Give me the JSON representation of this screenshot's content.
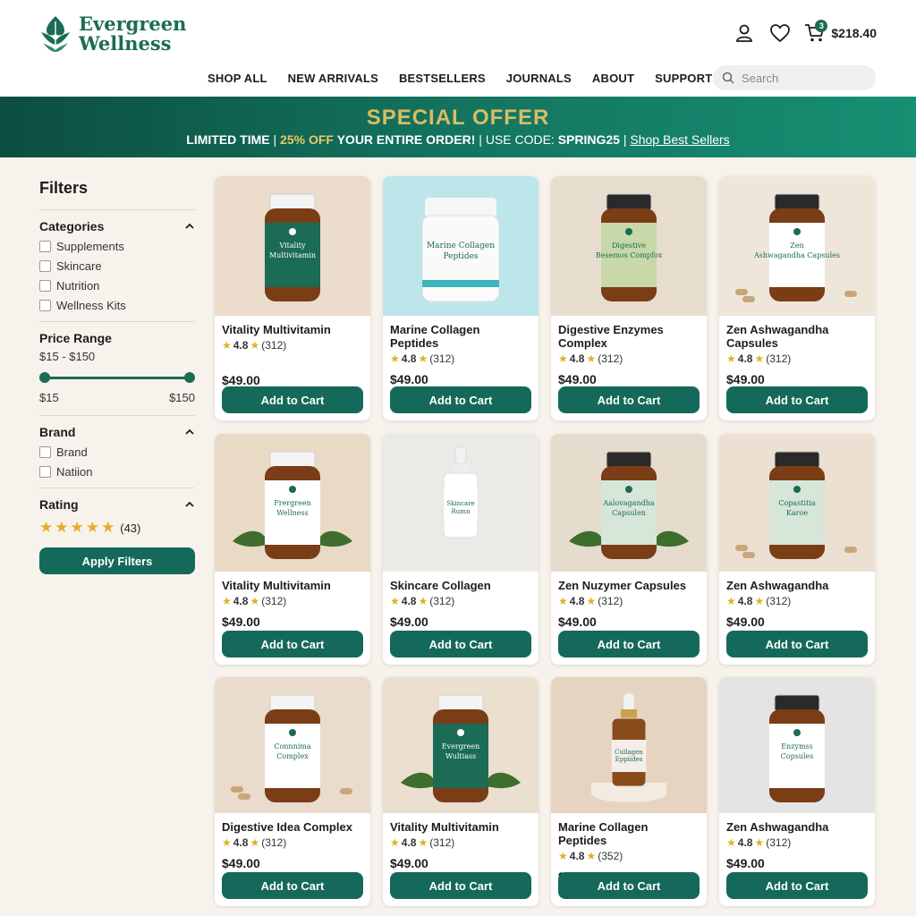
{
  "brand": {
    "line1": "Evergreen",
    "line2": "Wellness"
  },
  "header": {
    "cart_count": "3",
    "cart_total": "$218.40"
  },
  "nav": [
    "SHOP ALL",
    "NEW ARRIVALS",
    "BESTSELLERS",
    "JOURNALS",
    "ABOUT",
    "SUPPORT"
  ],
  "search": {
    "placeholder": "Search"
  },
  "banner": {
    "title": "SPECIAL OFFER",
    "limited": "LIMITED TIME",
    "discount": "25% OFF",
    "rest": "YOUR ENTIRE ORDER!",
    "code_label": "USE CODE:",
    "code": "SPRING25",
    "link": "Shop Best Sellers"
  },
  "filters": {
    "title": "Filters",
    "categories": {
      "title": "Categories",
      "items": [
        "Supplements",
        "Skincare",
        "Nutrition",
        "Wellness Kits"
      ]
    },
    "price": {
      "title": "Price Range",
      "range": "$15 - $150",
      "min": "$15",
      "max": "$150"
    },
    "brand": {
      "title": "Brand",
      "items": [
        "Brand",
        "Natiion"
      ]
    },
    "rating": {
      "title": "Rating",
      "count": "(43)"
    },
    "apply": "Apply Filters"
  },
  "products": [
    {
      "name": "Vitality Multivitamin",
      "label": "Vitality Multivitamin",
      "rating": "4.8",
      "reviews": "(312)",
      "price": "$49.00",
      "button": "Add to Cart",
      "bg": "#ebdccb",
      "label_color": "#1b6b55"
    },
    {
      "name": "Marine Collagen Peptides",
      "label": "Marine Collagen Peptides",
      "rating": "4.8",
      "reviews": "(312)",
      "price": "$49.00",
      "button": "Add to Cart",
      "bg": "#bde6ea",
      "label_color": "#ffffff"
    },
    {
      "name": "Digestive Enzymes Complex",
      "label": "Digestive Besemos Compfox",
      "rating": "4.8",
      "reviews": "(312)",
      "price": "$49.00",
      "button": "Add to Cart",
      "bg": "#e7ddcf",
      "label_color": "#c8d8a8"
    },
    {
      "name": "Zen Ashwagandha Capsules",
      "label": "Zen Ashwagandha Capsules",
      "rating": "4.8",
      "reviews": "(312)",
      "price": "$49.00",
      "button": "Add to Cart",
      "bg": "#efe6da",
      "label_color": "#ffffff"
    },
    {
      "name": "Vitality Multivitamin",
      "label": "Frergreen Wellness",
      "rating": "4.8",
      "reviews": "(312)",
      "price": "$49.00",
      "button": "Add to Cart",
      "bg": "#e9dac6",
      "label_color": "#ffffff"
    },
    {
      "name": "Skincare Collagen",
      "label": "Skincare Rumn",
      "rating": "4.8",
      "reviews": "(312)",
      "price": "$49.00",
      "button": "Add to Cart",
      "bg": "#eceae6",
      "label_color": "#ffffff"
    },
    {
      "name": "Zen Nuzymer Capsules",
      "label": "Aalovagandha Capsulen",
      "rating": "4.8",
      "reviews": "(312)",
      "price": "$49.00",
      "button": "Add to Cart",
      "bg": "#e6dccd",
      "label_color": "#d6e6d8"
    },
    {
      "name": "Zen Ashwagandha",
      "label": "Copastitia Karoe",
      "rating": "4.8",
      "reviews": "(312)",
      "price": "$49.00",
      "button": "Add to Cart",
      "bg": "#ebe0d2",
      "label_color": "#d6e6d8"
    },
    {
      "name": "Digestive Idea Complex",
      "label": "Connnima Complex",
      "rating": "4.8",
      "reviews": "(312)",
      "price": "$49.00",
      "button": "Add to Cart",
      "bg": "#eadccc",
      "label_color": "#ffffff"
    },
    {
      "name": "Vitality Multivitamin",
      "label": "Evergreen Wultiass",
      "rating": "4.8",
      "reviews": "(312)",
      "price": "$49.00",
      "button": "Add to Cart",
      "bg": "#ebdfd0",
      "label_color": "#1b6b55"
    },
    {
      "name": "Marine Collagen Peptides",
      "label": "Cullagen Eppiides",
      "rating": "4.8",
      "reviews": "(352)",
      "price": "$49.00",
      "button": "Add to Cart",
      "bg": "#e6d4c0",
      "label_color": "#ffffff"
    },
    {
      "name": "Zen Ashwagandha",
      "label": "Enzymss Copsules",
      "rating": "4.8",
      "reviews": "(312)",
      "price": "$49.00",
      "button": "Add to Cart",
      "bg": "#e4e4e4",
      "label_color": "#ffffff"
    }
  ]
}
